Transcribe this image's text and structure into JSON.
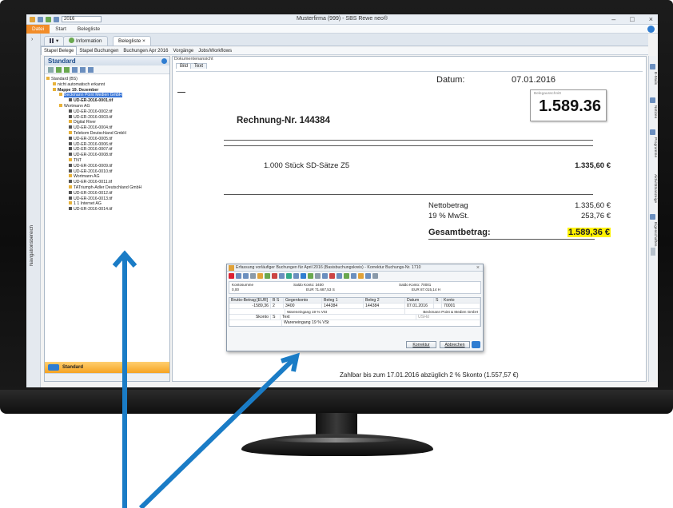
{
  "titlebar": {
    "year": "2016",
    "app_title": "Musterfirma (999) - SBS Rewe neo®",
    "minimize": "–",
    "maximize": "□",
    "close": "×"
  },
  "ribbon": {
    "tabs": [
      "Datei",
      "Start",
      "Belegliste"
    ]
  },
  "doc_tabs": {
    "info": "Information",
    "belegliste": "Belegliste"
  },
  "sub_tabs": [
    "Stapel Belege",
    "Stapel Buchungen",
    "Buchungen Apr 2016",
    "Vorgänge",
    "Jobs/Workflows"
  ],
  "left_strip_label": "Navigationsbereich",
  "panel": {
    "title": "Standard",
    "footer": "Standard",
    "tree": [
      {
        "text": "Standard (BS)",
        "indent": 0
      },
      {
        "text": "nicht automatisch erkannt",
        "indent": 2
      },
      {
        "text": "Mappe 19. Dezember",
        "indent": 2,
        "bold": true
      },
      {
        "text": "Beckmann Point Medien GmbH",
        "indent": 4,
        "selected": true
      },
      {
        "text": "UD-ER-2016-0001.tif",
        "indent": 7,
        "bold": true
      },
      {
        "text": "Wortmann AG",
        "indent": 4
      },
      {
        "text": "UD-ER-2016-0002.tif",
        "indent": 7
      },
      {
        "text": "UD-ER-2016-0003.tif",
        "indent": 7
      },
      {
        "text": "Digital River",
        "indent": 7
      },
      {
        "text": "UD-ER-2016-0004.tif",
        "indent": 7
      },
      {
        "text": "Telekom Deutschland GmbH",
        "indent": 7
      },
      {
        "text": "UD-ER-2016-0005.tif",
        "indent": 7
      },
      {
        "text": "UD-ER-2016-0006.tif",
        "indent": 7
      },
      {
        "text": "UD-ER-2016-0007.tif",
        "indent": 7
      },
      {
        "text": "UD-ER-2016-0008.tif",
        "indent": 7
      },
      {
        "text": "TNT",
        "indent": 7
      },
      {
        "text": "UD-ER-2016-0009.tif",
        "indent": 7
      },
      {
        "text": "UD-ER-2016-0010.tif",
        "indent": 7
      },
      {
        "text": "Wortmann AG",
        "indent": 7
      },
      {
        "text": "UD-ER-2016-0011.tif",
        "indent": 7
      },
      {
        "text": "TATriumph-Adler Deutschland GmbH",
        "indent": 7
      },
      {
        "text": "UD-ER-2016-0012.tif",
        "indent": 7
      },
      {
        "text": "UD-ER-2016-0013.tif",
        "indent": 7
      },
      {
        "text": "1 1 Internet AG",
        "indent": 7
      },
      {
        "text": "UD-ER-2016-0014.tif",
        "indent": 7
      }
    ]
  },
  "docview": {
    "label": "Dokumentenansicht",
    "tab_bild": "Bild",
    "tab_text": "Text"
  },
  "invoice": {
    "datum_label": "Datum:",
    "datum_value": "07.01.2016",
    "stamp_label": "Belegausschnitt",
    "stamp_amount": "1.589.36",
    "rechnung": "Rechnung-Nr. 144384",
    "item_desc": "1.000  Stück  SD-Sätze Z5",
    "item_amount": "1.335,60 €",
    "netto_label": "Nettobetrag",
    "netto_value": "1.335,60 €",
    "mwst_label": "19 % MwSt.",
    "mwst_value": "253,76 €",
    "gesamt_label": "Gesamtbetrag:",
    "gesamt_value": "1.589,36 €",
    "zahlbar": "Zahlbar bis zum 17.01.2016 abzüglich 2 % Skonto (1.557,57 €)"
  },
  "right_strip": [
    "E-Mails",
    "Notizen",
    "Programme",
    "Aktivitätsanzeige",
    "Eigenschaften"
  ],
  "dialog": {
    "title": "Erfassung vorläufiger Buchungen für April 2016 (Basisbuchungskreis) - Korrektur Buchungs-Nr. 1710",
    "kontosumme_label": "Kontosumme",
    "kontosumme_value": "0,00",
    "saldo1_label": "Saldo Konto: 3400",
    "saldo1_value": "EUR  71.687,53 S",
    "saldo2_label": "Saldo Konto: 70001",
    "saldo2_value": "EUR  87.015,14  H",
    "grid_headers": [
      "Brutto-Betrag [EUR]",
      "B S",
      "Gegenkonto",
      "Beleg 1",
      "Beleg 2",
      "Datum",
      "S",
      "Konto"
    ],
    "grid_row": [
      "-1589,36",
      "2",
      "3400",
      "144384",
      "144384",
      "07.01.2016",
      "",
      "70001"
    ],
    "hint1_left": "Wareneingang 19 % VSt",
    "hint1_right": "Beckmann Point & Medien GmbH",
    "skonto_label": "Skonto",
    "s_label": "S",
    "text_label": "Text",
    "ushd": "USHd",
    "text_value": "Wareneingang 19 % VSt",
    "btn_korrektur": "Korrektur",
    "btn_abbrechen": "Abbrechen"
  },
  "colors": {
    "accent_blue": "#1a7cc6",
    "highlight": "#fff200",
    "file_tab": "#f28c28"
  }
}
